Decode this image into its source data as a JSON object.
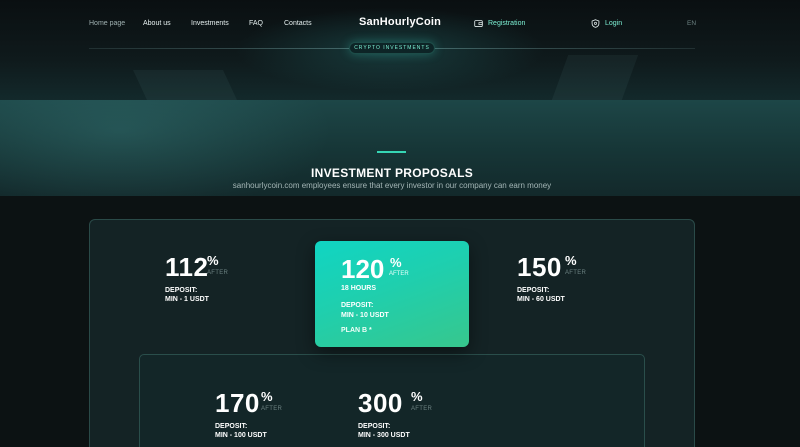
{
  "nav": {
    "links": [
      "Home page",
      "About us",
      "Investments",
      "FAQ",
      "Contacts"
    ],
    "logo": "SanHourlyCoin",
    "registration": "Registration",
    "login": "Login",
    "lang": "EN",
    "badge": "CRYPTO INVESTMENTS"
  },
  "section": {
    "title": "INVESTMENT PROPOSALS",
    "subtitle": "sanhourlycoin.com employees ensure that every investor in our company can earn money"
  },
  "plans": [
    {
      "percent": "112",
      "pct_sign": "%",
      "after": "AFTER",
      "deposit_label": "DEPOSIT:",
      "min": "MIN - 1 USDT"
    },
    {
      "percent": "120",
      "pct_sign": "%",
      "after": "AFTER",
      "hours": "18 HOURS",
      "deposit_label": "DEPOSIT:",
      "min": "MIN - 10 USDT",
      "plan": "PLAN B *"
    },
    {
      "percent": "150",
      "pct_sign": "%",
      "after": "AFTER",
      "deposit_label": "DEPOSIT:",
      "min": "MIN - 60 USDT"
    },
    {
      "percent": "170",
      "pct_sign": "%",
      "after": "AFTER",
      "deposit_label": "DEPOSIT:",
      "min": "MIN - 100 USDT"
    },
    {
      "percent": "300",
      "pct_sign": "%",
      "after": "AFTER",
      "deposit_label": "DEPOSIT:",
      "min": "MIN - 300 USDT"
    }
  ],
  "colors": {
    "accent": "#36d6b4",
    "featured_start": "#10d5c3",
    "featured_end": "#37c78d",
    "background": "#0c1213"
  },
  "icons": {
    "registration": "wallet-icon",
    "login": "shield-icon"
  }
}
